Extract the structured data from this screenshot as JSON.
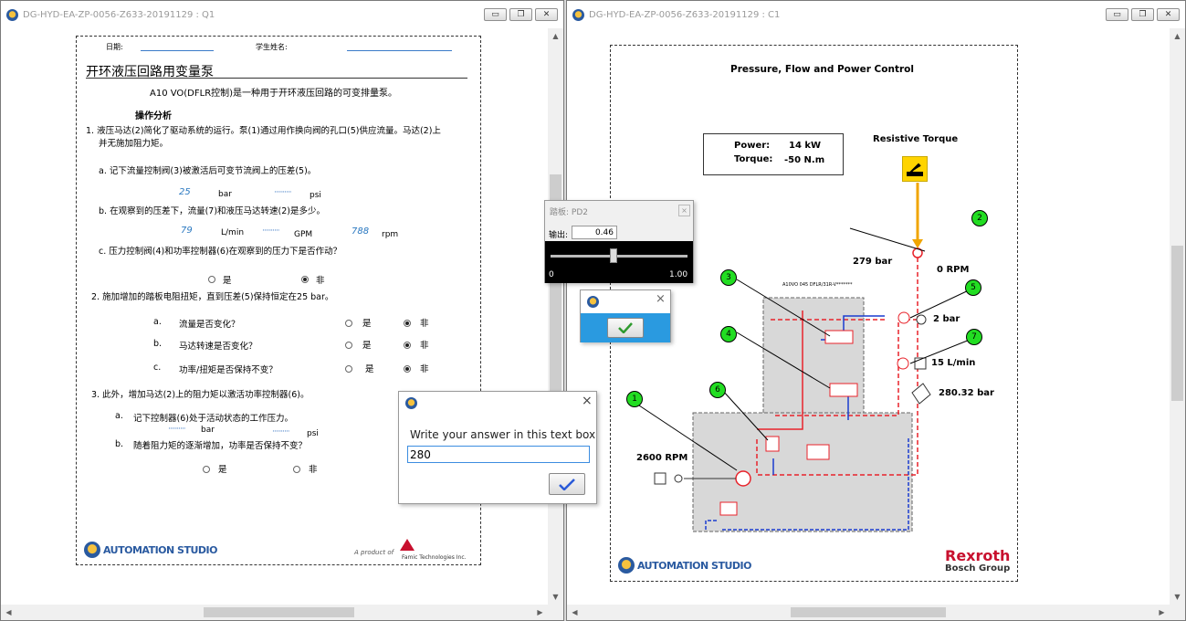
{
  "left_window": {
    "title": "DG-HYD-EA-ZP-0056-Z633-20191129 : Q1",
    "buttons": [
      "minimize",
      "restore",
      "close"
    ]
  },
  "right_window": {
    "title": "DG-HYD-EA-ZP-0056-Z633-20191129 : C1",
    "buttons": [
      "minimize",
      "restore",
      "close"
    ]
  },
  "question_doc": {
    "date_label": "日期:",
    "student_label": "学生姓名:",
    "title": "开环液压回路用变量泵",
    "subtitle": "A10 VO(DFLR控制)是一种用于开环液压回路的可变排量泵。",
    "section": "操作分析",
    "q1_text": "1.  液压马达(2)简化了驱动系统的运行。泵(1)通过用作换向阀的孔口(5)供应流量。马达(2)上",
    "q1_text2": "并无施加阻力矩。",
    "q1a": "a.  记下流量控制阀(3)被激活后可变节流阀上的压差(5)。",
    "q1a_value": "25",
    "q1a_unit1": "bar",
    "q1a_dots": "··········",
    "q1a_unit2": "psi",
    "q1b": "b.  在观察到的压差下，流量(7)和液压马达转速(2)是多少。",
    "q1b_flow": "79",
    "q1b_unit1": "L/min",
    "q1b_dots": "··········",
    "q1b_unit2": "GPM",
    "q1b_speed": "788",
    "q1b_unit3": "rpm",
    "q1c": "c.  压力控制阀(4)和功率控制器(6)在观察到的压力下是否作动？",
    "yes": "是",
    "no": "非",
    "q2": "2.   施加增加的踏板电阻扭矩，直到压差(5)保持恒定在25 bar。",
    "q2a_letter": "a.",
    "q2a": "流量是否变化？",
    "q2b_letter": "b.",
    "q2b": "马达转速是否变化？",
    "q2c_letter": "c.",
    "q2c": "功率/扭矩是否保持不变？",
    "q3": "3.   此外，增加马达(2)上的阻力矩以激活功率控制器(6)。",
    "q3a_letter": "a.",
    "q3a": "记下控制器(6)处于活动状态的工作压力。",
    "q3a_dots": "··········",
    "q3a_unit1": "bar",
    "q3a_dots2": "··········",
    "q3a_unit2": "psi",
    "q3b_letter": "b.",
    "q3b": "随着阻力矩的逐渐增加，功率是否保持不变？",
    "logo": "AUTOMATION STUDIO",
    "product_of": "A product of",
    "famic": "Famic Technologies Inc."
  },
  "circuit_doc": {
    "title": "Pressure, Flow and Power Control",
    "power_label": "Power:",
    "power_value": "14 kW",
    "torque_label": "Torque:",
    "torque_value": "-50 N.m",
    "resistive": "Resistive Torque",
    "p279": "279 bar",
    "rpm0": "0 RPM",
    "bar2": "2 bar",
    "flow15": "15 L/min",
    "p280": "280.32 bar",
    "rpm2600": "2600 RPM",
    "pump_label": "A10VO 045 DFLR/31R-V*******",
    "callouts": [
      "1",
      "2",
      "3",
      "4",
      "5",
      "6",
      "7"
    ],
    "logo": "AUTOMATION STUDIO",
    "brand": "Rexroth",
    "brand_sub": "Bosch Group"
  },
  "pedal_dialog": {
    "title": "踏板: PD2",
    "output_label": "输出:",
    "output_value": "0.46",
    "slider_min": "0",
    "slider_max": "1.00",
    "slider_level": 0.46
  },
  "small_confirm": {
    "close": "×"
  },
  "answer_dialog": {
    "prompt": "Write your answer in this text box",
    "value": "280",
    "close": "×"
  },
  "colors": {
    "pressure": "#e8222a",
    "return": "#1a3ccf",
    "callout": "#22dd22",
    "accent": "#2a78c0"
  }
}
